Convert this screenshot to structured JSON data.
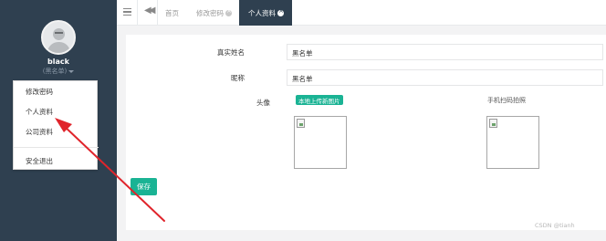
{
  "sidebar": {
    "username": "black",
    "role": "(黑名单)",
    "dropdown": {
      "items": [
        {
          "label": "修改密码"
        },
        {
          "label": "个人资料"
        },
        {
          "label": "公司资料"
        },
        {
          "label": "安全退出"
        }
      ]
    }
  },
  "topbar": {
    "tabs": [
      {
        "label": "首页"
      },
      {
        "label": "修改密码"
      },
      {
        "label": "个人资料"
      }
    ],
    "active_tab": "个人资料"
  },
  "form": {
    "real_name_label": "真实姓名",
    "real_name_value": "黑名单",
    "nickname_label": "昵称",
    "nickname_value": "黑名单",
    "avatar_label": "头像",
    "upload_button": "本地上传新图片",
    "qr_label": "手机扫码拍照",
    "save_button": "保存"
  },
  "watermark": "CSDN @tianh",
  "colors": {
    "sidebar": "#2f4050",
    "accent": "#1ab394",
    "arrow": "#e0242b"
  }
}
